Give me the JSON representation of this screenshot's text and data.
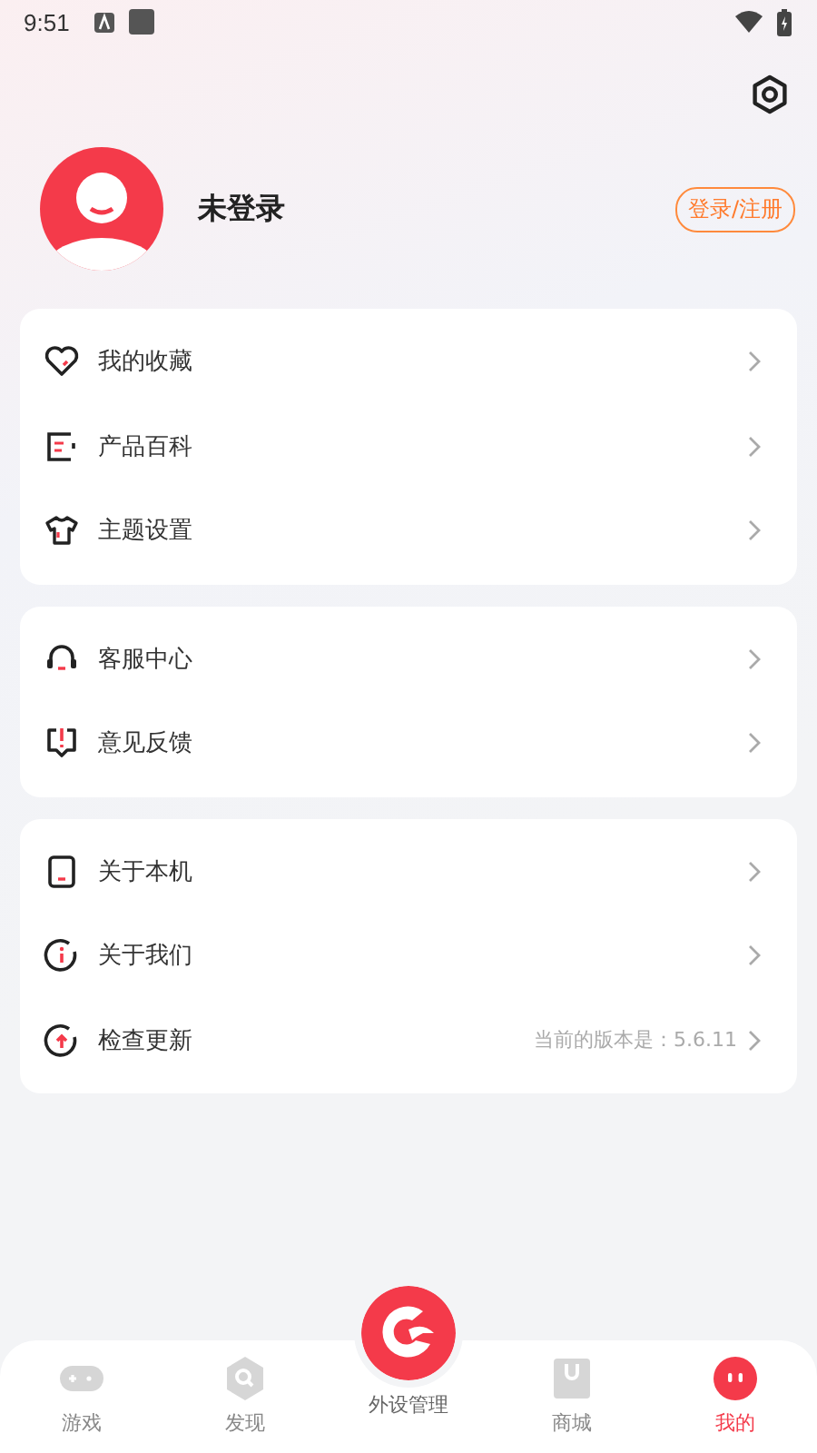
{
  "status_bar": {
    "time": "9:51"
  },
  "profile": {
    "name": "未登录",
    "login_button": "登录/注册"
  },
  "menu_groups": [
    {
      "items": [
        {
          "kind": "heart",
          "label": "我的收藏"
        },
        {
          "kind": "doc",
          "label": "产品百科"
        },
        {
          "kind": "shirt",
          "label": "主题设置"
        }
      ]
    },
    {
      "items": [
        {
          "kind": "headset",
          "label": "客服中心"
        },
        {
          "kind": "feedback",
          "label": "意见反馈"
        }
      ]
    },
    {
      "items": [
        {
          "kind": "device",
          "label": "关于本机"
        },
        {
          "kind": "info",
          "label": "关于我们"
        },
        {
          "kind": "update",
          "label": "检查更新",
          "value": "当前的版本是：5.6.11"
        }
      ]
    }
  ],
  "bottom_nav": [
    {
      "kind": "gamepad",
      "label": "游戏",
      "selected": false
    },
    {
      "kind": "search",
      "label": "发现",
      "selected": false
    },
    {
      "kind": "center",
      "label": "外设管理",
      "selected": false
    },
    {
      "kind": "bag",
      "label": "商城",
      "selected": false
    },
    {
      "kind": "face",
      "label": "我的",
      "selected": true
    }
  ]
}
